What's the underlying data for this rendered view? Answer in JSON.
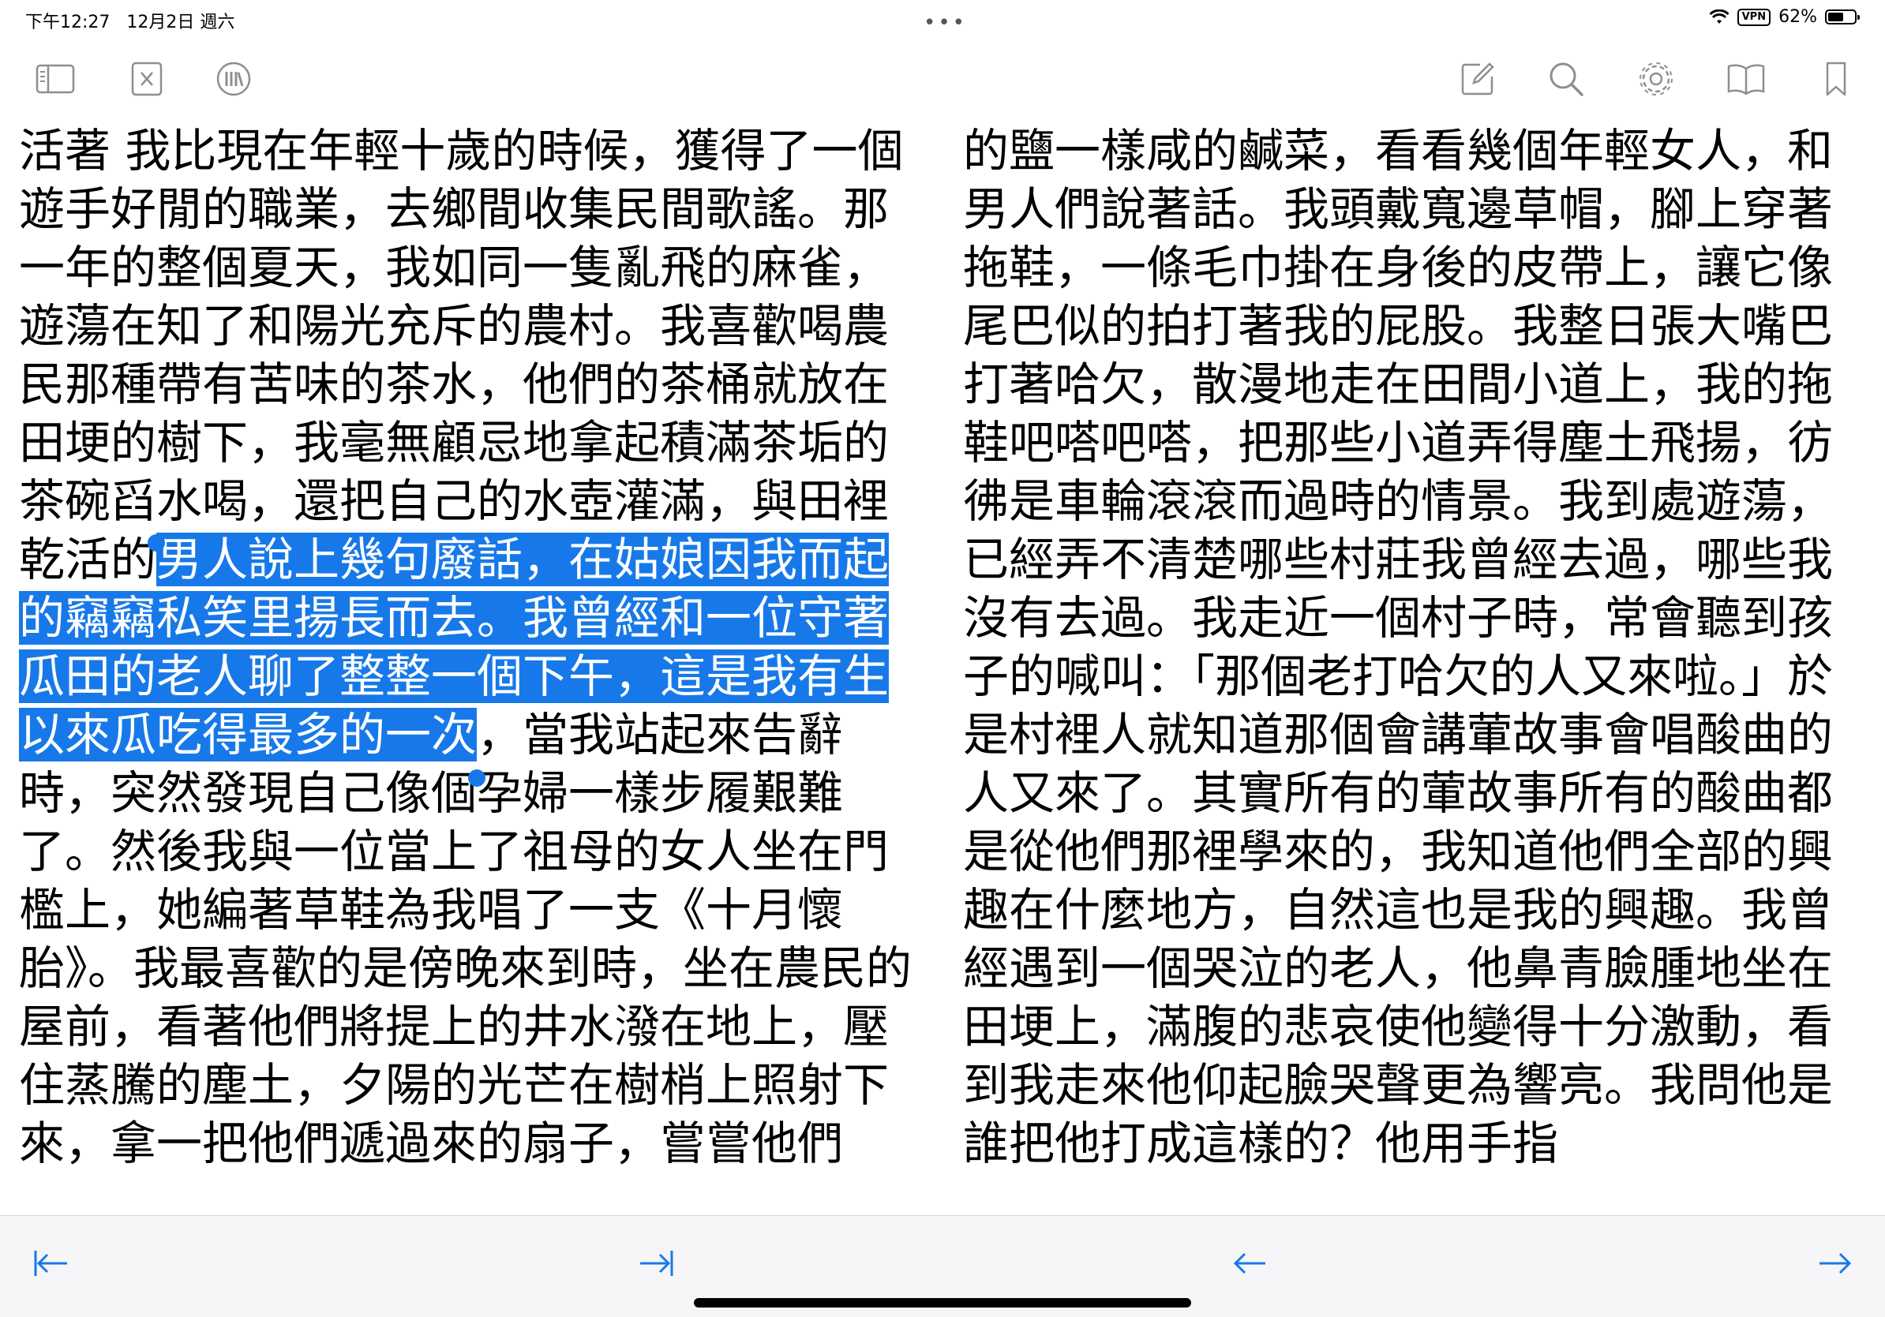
{
  "status_bar": {
    "time": "下午12:27",
    "date": "12月2日 週六",
    "vpn": "VPN",
    "battery_text": "62%",
    "battery_level_percent": 62
  },
  "toolbar": {
    "left_icons": [
      "sidebar-icon",
      "close-book-icon",
      "library-icon"
    ],
    "right_icons": [
      "annotate-icon",
      "search-icon",
      "gear-icon",
      "open-book-icon",
      "bookmark-icon"
    ]
  },
  "left_page": {
    "text_before": "活著 我比現在年輕十歲的時候，獲得了一個遊手好閒的職業，去鄉間收集民間歌謠。那一年的整個夏天，我如同一隻亂飛的麻雀，遊蕩在知了和陽光充斥的農村。我喜歡喝農民那種帶有苦味的茶水，他們的茶桶就放在田埂的樹下，我毫無顧忌地拿起積滿茶垢的茶碗舀水喝，還把自己的水壺灌滿，與田裡乾活的",
    "text_selected": "男人說上幾句廢話，在姑娘因我而起的竊竊私笑里揚長而去。我曾經和一位守著瓜田的老人聊了整整一個下午，這是我有生以來瓜吃得最多的一次",
    "text_after": "，當我站起來告辭時，突然發現自己像個孕婦一樣步履艱難了。然後我與一位當上了祖母的女人坐在門檻上，她編著草鞋為我唱了一支《十月懷胎》。我最喜歡的是傍晚來到時，坐在農民的屋前，看著他們將提上的井水潑在地上，壓住蒸騰的塵土，夕陽的光芒在樹梢上照射下來，拿一把他們遞過來的扇子，嘗嘗他們"
  },
  "right_page": {
    "text": "的鹽一樣咸的鹹菜，看看幾個年輕女人，和男人們說著話。我頭戴寬邊草帽，腳上穿著拖鞋，一條毛巾掛在身後的皮帶上，讓它像尾巴似的拍打著我的屁股。我整日張大嘴巴打著哈欠，散漫地走在田間小道上，我的拖鞋吧嗒吧嗒，把那些小道弄得塵土飛揚，彷彿是車輪滾滾而過時的情景。我到處遊蕩，已經弄不清楚哪些村莊我曾經去過，哪些我沒有去過。我走近一個村子時，常會聽到孩子的喊叫：「那個老打哈欠的人又來啦。」於是村裡人就知道那個會講葷故事會唱酸曲的人又來了。其實所有的葷故事所有的酸曲都是從他們那裡學來的，我知道他們全部的興趣在什麼地方，自然這也是我的興趣。我曾經遇到一個哭泣的老人，他鼻青臉腫地坐在田埂上，滿腹的悲哀使他變得十分激動，看到我走來他仰起臉哭聲更為響亮。我問他是誰把他打成這樣的？他用手指"
  },
  "bottom_bar": {
    "buttons": [
      "first-page-arrow-icon",
      "last-page-arrow-icon",
      "previous-page-arrow-icon",
      "next-page-arrow-icon"
    ]
  },
  "colors": {
    "accent": "#1779e9",
    "icon_gray": "#8e8e93",
    "bottom_bar_bg": "#f6f6f8"
  }
}
